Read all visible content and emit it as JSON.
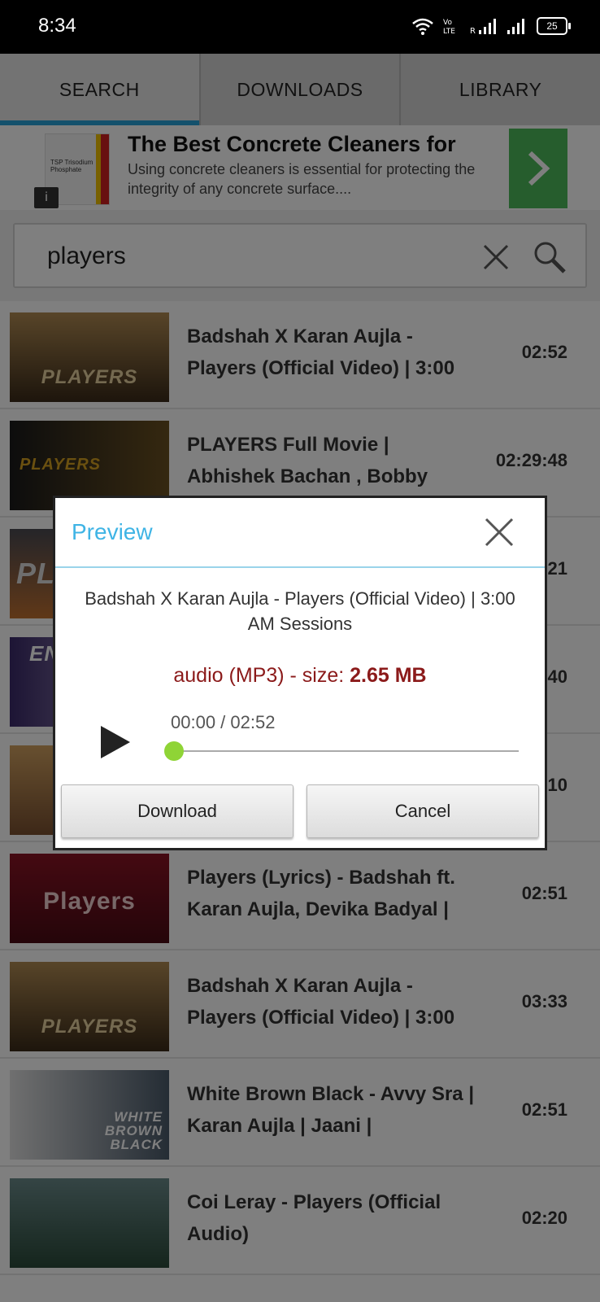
{
  "status": {
    "time": "8:34",
    "battery": "25"
  },
  "tabs": [
    {
      "label": "SEARCH",
      "active": true
    },
    {
      "label": "DOWNLOADS",
      "active": false
    },
    {
      "label": "LIBRARY",
      "active": false
    }
  ],
  "ad": {
    "title": "The Best Concrete Cleaners for",
    "description": "Using concrete cleaners is essential for protecting the integrity of any concrete surface....",
    "info_icon": "info-icon",
    "thumb_text": "TSP Trisodium Phosphate"
  },
  "search": {
    "query": "players"
  },
  "results": [
    {
      "title": "Badshah X Karan Aujla - Players (Official Video) | 3:00",
      "duration": "02:52",
      "thumb_label": "PLAYERS",
      "thumb_color": "#8a6a3a"
    },
    {
      "title": "PLAYERS Full Movie | Abhishek Bachan , Bobby",
      "duration": "02:29:48",
      "thumb_label": "PLAYERS",
      "thumb_color": "#2a2a2a"
    },
    {
      "title": "",
      "duration": "21",
      "thumb_label": "PL",
      "thumb_color": "#5a4a3a"
    },
    {
      "title": "",
      "duration": "40",
      "thumb_label": "EN",
      "thumb_color": "#5a4a8a"
    },
    {
      "title": "",
      "duration": "10",
      "thumb_label": "",
      "thumb_color": "#c8a070"
    },
    {
      "title": "Players (Lyrics) - Badshah ft. Karan Aujla, Devika Badyal |",
      "duration": "02:51",
      "thumb_label": "Players",
      "thumb_color": "#7a1020"
    },
    {
      "title": "Badshah X Karan Aujla - Players (Official Video) | 3:00",
      "duration": "03:33",
      "thumb_label": "PLAYERS",
      "thumb_color": "#8a6a3a"
    },
    {
      "title": "White Brown Black - Avvy Sra | Karan Aujla | Jaani |",
      "duration": "02:51",
      "thumb_label": "WHITE BROWN BLACK",
      "thumb_color": "#6a7a8a"
    },
    {
      "title": "Coi Leray - Players (Official Audio)",
      "duration": "02:20",
      "thumb_label": "",
      "thumb_color": "#3a6a6a"
    }
  ],
  "dialog": {
    "title": "Preview",
    "video_name": "Badshah X Karan Aujla - Players (Official Video) | 3:00 AM Sessions",
    "format_text": "audio (MP3) - size: ",
    "size": "2.65 MB",
    "time": "00:00 / 02:52",
    "progress": 0,
    "download_label": "Download",
    "cancel_label": "Cancel"
  }
}
